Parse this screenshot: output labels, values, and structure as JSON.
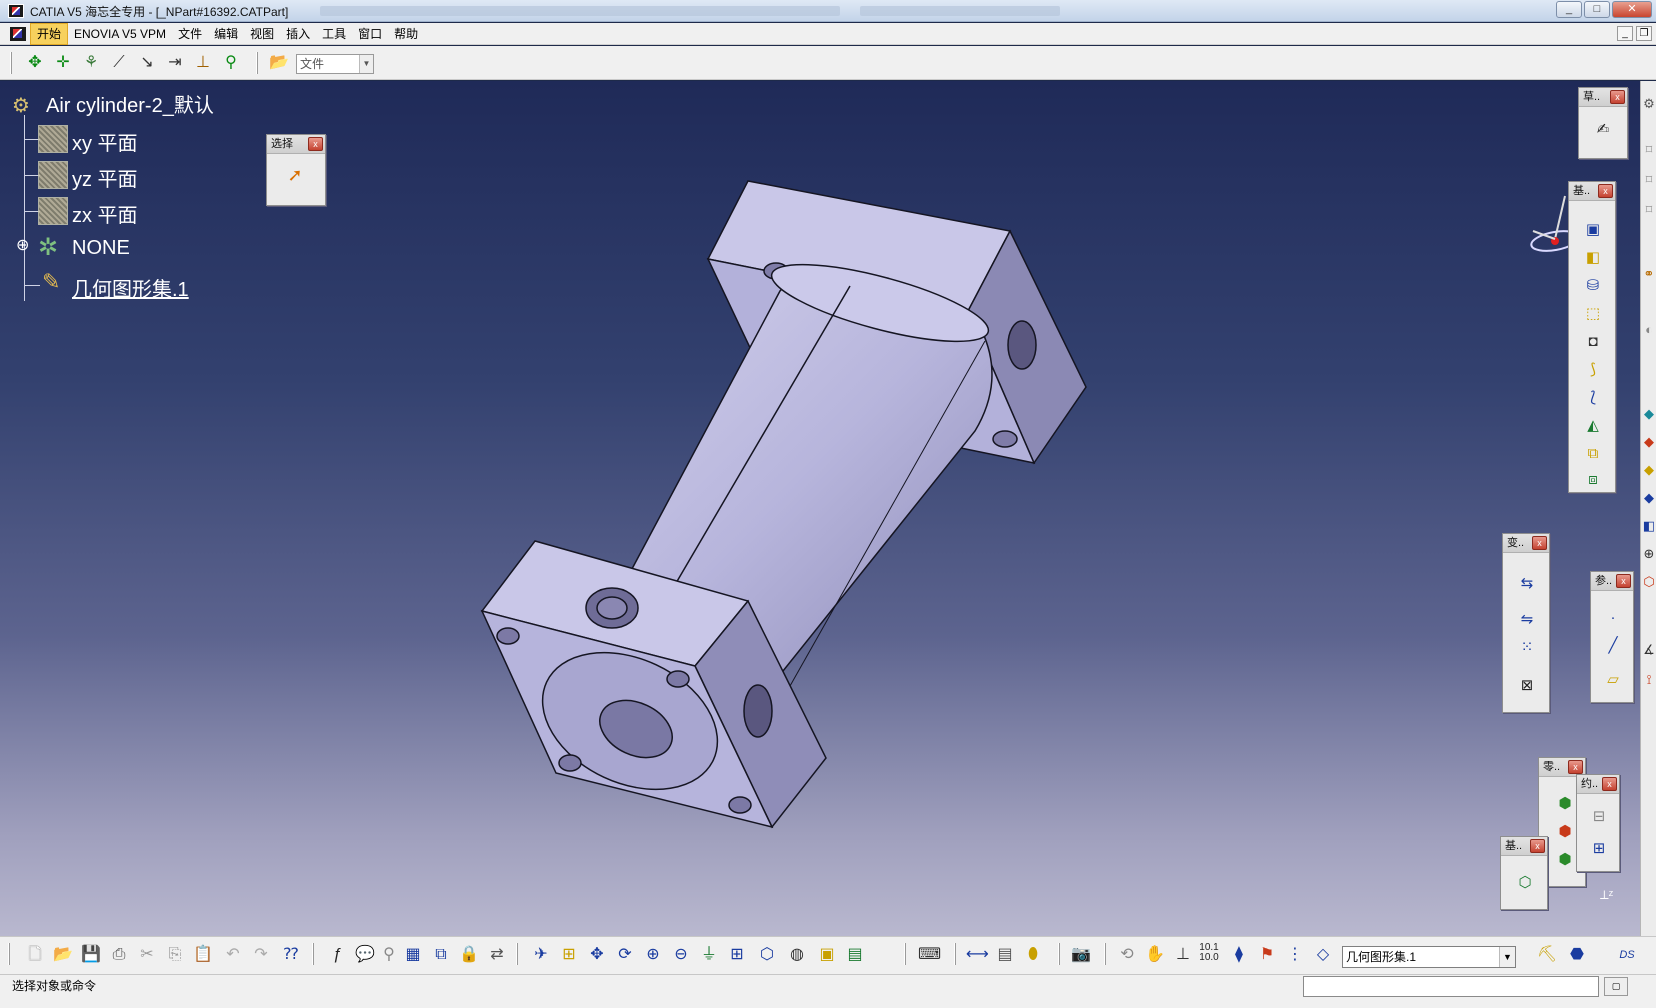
{
  "window": {
    "title": "CATIA V5  海忘全专用 - [_NPart#16392.CATPart]",
    "controls": {
      "minimize": "_",
      "maximize": "□",
      "close": "✕"
    }
  },
  "menu": {
    "items": [
      "开始",
      "ENOVIA V5 VPM",
      "文件",
      "编辑",
      "视图",
      "插入",
      "工具",
      "窗口",
      "帮助"
    ],
    "active_index": 0
  },
  "top_toolbar": {
    "file_combo_value": "文件"
  },
  "tree": {
    "root": "Air cylinder-2_默认",
    "items": [
      {
        "label": "xy 平面",
        "icon": "plane-icon"
      },
      {
        "label": "yz 平面",
        "icon": "plane-icon"
      },
      {
        "label": "zx 平面",
        "icon": "plane-icon"
      },
      {
        "label": "NONE",
        "icon": "gear-icon"
      },
      {
        "label": "几何图形集.1",
        "icon": "geometry-set-icon",
        "underlined": true
      }
    ]
  },
  "floating_toolbars": {
    "select": {
      "title": "选择",
      "close": "x"
    },
    "sketch": {
      "title": "草..",
      "close": "x"
    },
    "base_features": {
      "title": "基..",
      "close": "x"
    },
    "transform": {
      "title": "变..",
      "close": "x"
    },
    "reference": {
      "title": "参..",
      "close": "x"
    },
    "part_ops": {
      "title": "零..",
      "close": "x"
    },
    "constraint": {
      "title": "约..",
      "close": "x"
    },
    "base2": {
      "title": "基..",
      "close": "x"
    }
  },
  "bottom_toolbar": {
    "geometry_combo_value": "几何图形集.1",
    "counter_label": "10.1\n10.0"
  },
  "status_bar": {
    "message": "选择对象或命令"
  },
  "colors": {
    "viewport_top": "#1f2a58",
    "viewport_bottom": "#b9b8cf",
    "part_fill": "#b4b3dc",
    "part_edge": "#1a1a2a",
    "active_menu": "#f7d15d"
  }
}
